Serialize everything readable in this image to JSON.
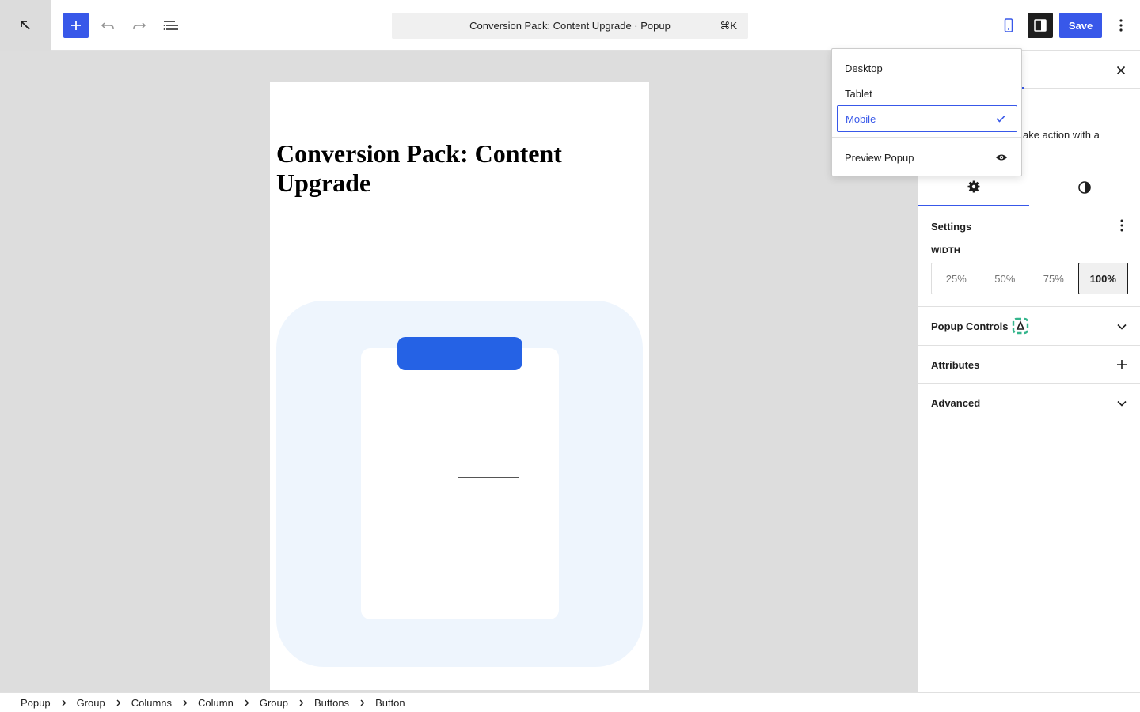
{
  "toolbar": {
    "document_title": "Conversion Pack: Content Upgrade · Popup",
    "shortcut": "⌘K",
    "save_label": "Save"
  },
  "canvas": {
    "heading": "Conversion Pack: Content Upgrade"
  },
  "sidebar": {
    "description_fragment": "ake action with a",
    "settings_title": "Settings",
    "width_label": "WIDTH",
    "width_options": [
      "25%",
      "50%",
      "75%",
      "100%"
    ],
    "width_selected": "100%",
    "sections": {
      "popup_controls": "Popup Controls",
      "attributes": "Attributes",
      "advanced": "Advanced"
    }
  },
  "device_menu": {
    "items": [
      "Desktop",
      "Tablet",
      "Mobile"
    ],
    "selected": "Mobile",
    "preview_label": "Preview Popup"
  },
  "breadcrumb": [
    "Popup",
    "Group",
    "Columns",
    "Column",
    "Group",
    "Buttons",
    "Button"
  ],
  "colors": {
    "accent": "#3858e9",
    "illustration_bg": "#eef5fd",
    "illustration_clip": "#2562e5",
    "canvas_bg": "#dddddd"
  }
}
